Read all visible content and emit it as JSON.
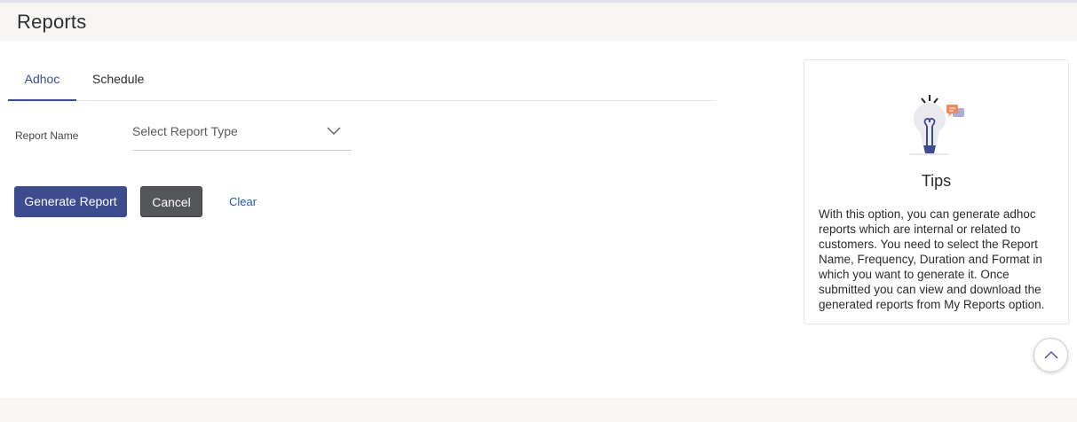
{
  "header": {
    "title": "Reports"
  },
  "tabs": [
    {
      "label": "Adhoc",
      "active": true
    },
    {
      "label": "Schedule",
      "active": false
    }
  ],
  "form": {
    "report_name_label": "Report Name",
    "report_type_placeholder": "Select Report Type"
  },
  "actions": {
    "generate_label": "Generate Report",
    "cancel_label": "Cancel",
    "clear_label": "Clear"
  },
  "tips": {
    "title": "Tips",
    "text": "With this option, you can generate adhoc reports which are internal or related to customers. You need to select the Report Name, Frequency, Duration and Format in which you want to generate it. Once submitted you can view and download the generated reports from My Reports option.",
    "icon": "lightbulb-icon"
  },
  "colors": {
    "accent": "#3d4b8f",
    "cancel": "#545659",
    "link": "#1d5fa9"
  },
  "icons": {
    "select_chevron": "chevron-down-icon",
    "scroll_top": "chevron-up-icon"
  }
}
